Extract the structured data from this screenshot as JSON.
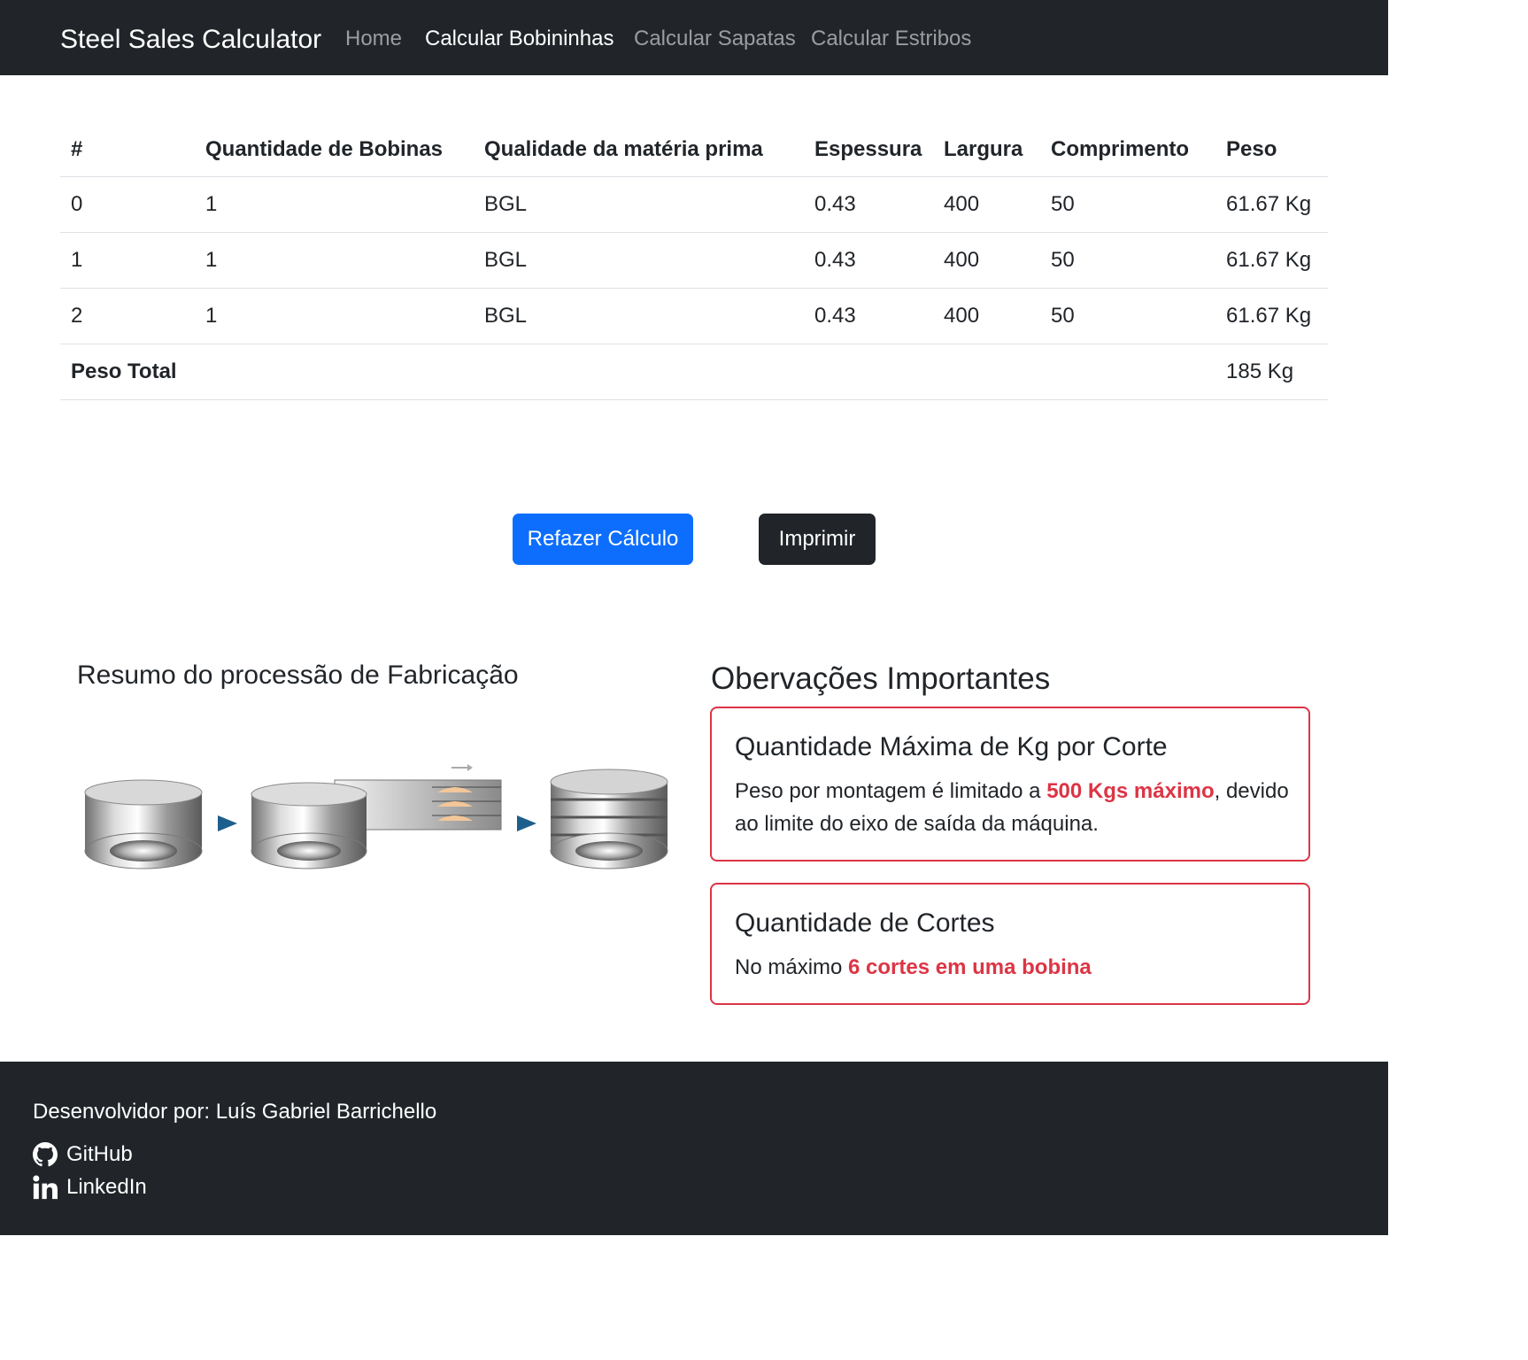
{
  "navbar": {
    "brand": "Steel Sales Calculator",
    "links": [
      {
        "label": "Home",
        "active": false
      },
      {
        "label": "Calcular Bobininhas",
        "active": true
      },
      {
        "label": "Calcular Sapatas",
        "active": false
      },
      {
        "label": "Calcular Estribos",
        "active": false
      }
    ]
  },
  "table": {
    "headers": [
      "#",
      "Quantidade de Bobinas",
      "Qualidade da matéria prima",
      "Espessura",
      "Largura",
      "Comprimento",
      "Peso"
    ],
    "rows": [
      [
        "0",
        "1",
        "BGL",
        "0.43",
        "400",
        "50",
        "61.67 Kg"
      ],
      [
        "1",
        "1",
        "BGL",
        "0.43",
        "400",
        "50",
        "61.67 Kg"
      ],
      [
        "2",
        "1",
        "BGL",
        "0.43",
        "400",
        "50",
        "61.67 Kg"
      ]
    ],
    "total_label": "Peso Total",
    "total_value": "185 Kg"
  },
  "actions": {
    "redo_label": "Refazer Cálculo",
    "print_label": "Imprimir"
  },
  "process": {
    "title": "Resumo do processão de Fabricação"
  },
  "observations": {
    "title": "Obervações Importantes",
    "cards": [
      {
        "title": "Quantidade Máxima de Kg por Corte",
        "text_before": "Peso por montagem é limitado a ",
        "emphasis": "500 Kgs máximo",
        "text_after": ", devido ao limite do eixo de saída da máquina."
      },
      {
        "title": "Quantidade de Cortes",
        "text_before": "No máximo ",
        "emphasis": "6 cortes em uma bobina",
        "text_after": ""
      }
    ]
  },
  "footer": {
    "credit": "Desenvolvidor por: Luís Gabriel Barrichello",
    "github_label": "GitHub",
    "linkedin_label": "LinkedIn"
  },
  "colors": {
    "navbar_bg": "#212529",
    "primary": "#0d6efd",
    "danger": "#dc3545"
  }
}
